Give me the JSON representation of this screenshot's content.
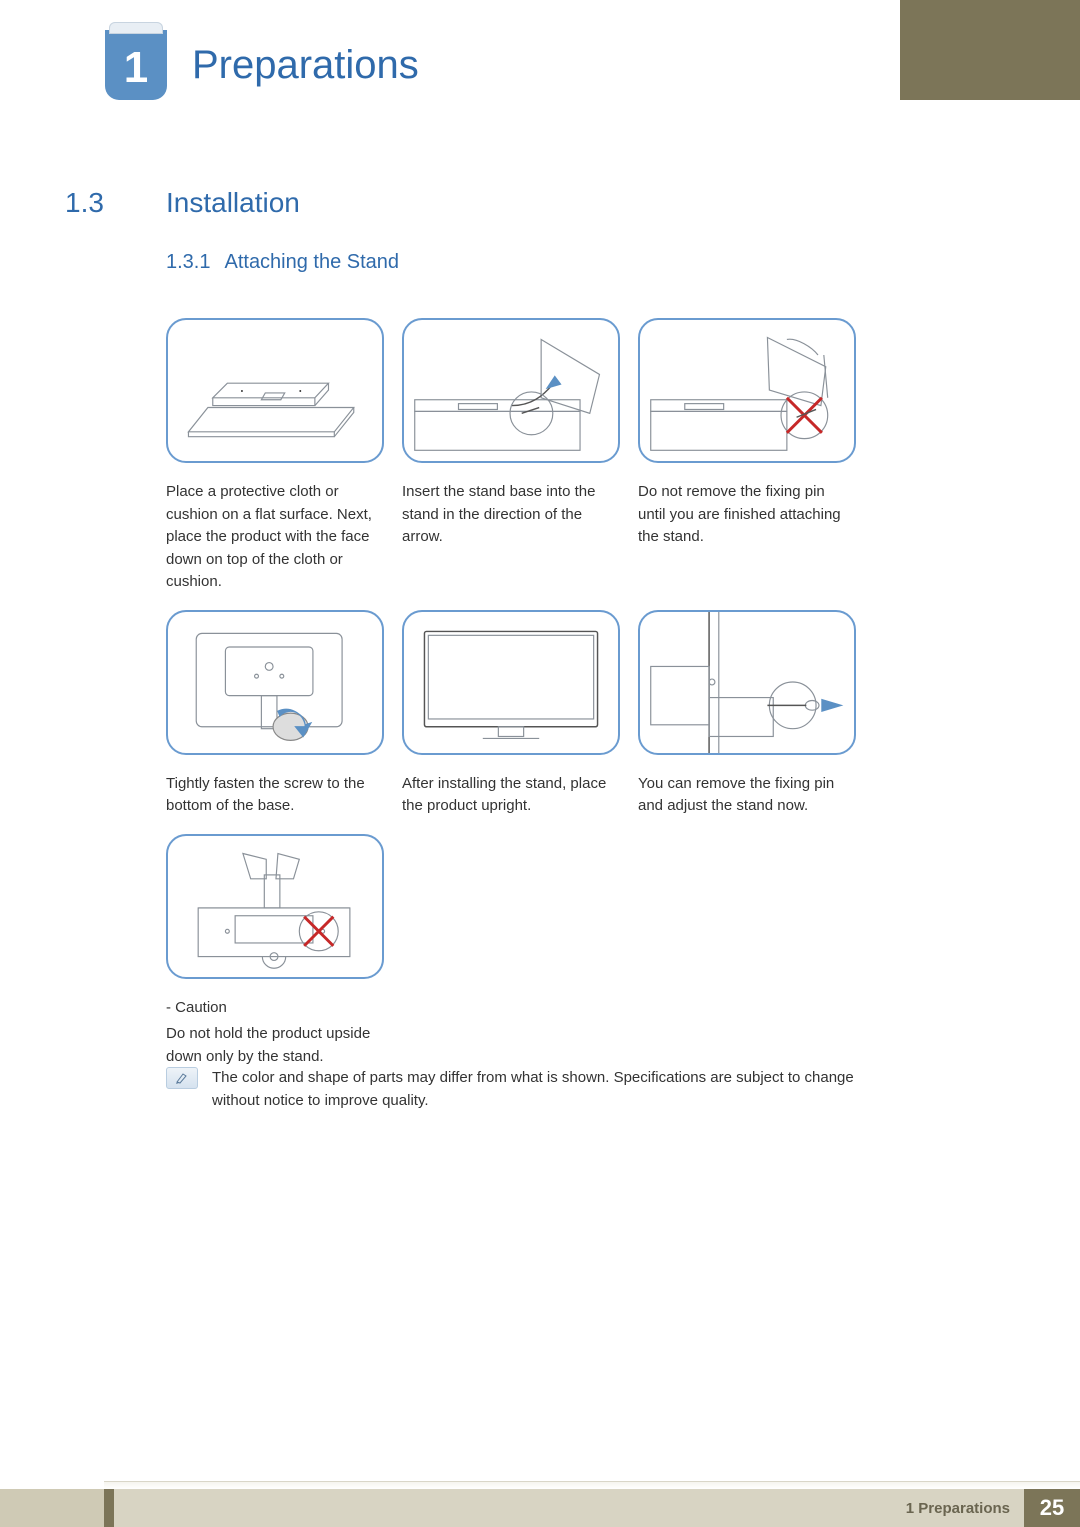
{
  "chapter": {
    "number": "1",
    "title": "Preparations"
  },
  "section": {
    "number": "1.3",
    "title": "Installation"
  },
  "subsection": {
    "number": "1.3.1",
    "title": "Attaching the Stand"
  },
  "steps": [
    {
      "caption": "Place a protective cloth or cushion on a flat surface. Next, place the product with the face down on top of the cloth or cushion."
    },
    {
      "caption": "Insert the stand base into the stand in the direction of the arrow."
    },
    {
      "caption": "Do not remove the fixing pin until you are finished attaching the stand."
    },
    {
      "caption": "Tightly fasten the screw to the bottom of the base."
    },
    {
      "caption": "After installing the stand, place the product upright."
    },
    {
      "caption": "You can remove the fixing pin and adjust the stand now."
    },
    {
      "caution_label": "- Caution",
      "caption": "Do not hold the product upside down only by the stand."
    }
  ],
  "note": "The color and shape of parts may differ from what is shown. Specifications are subject to change without notice to improve quality.",
  "footer": {
    "section_label": "1 Preparations",
    "page": "25"
  }
}
